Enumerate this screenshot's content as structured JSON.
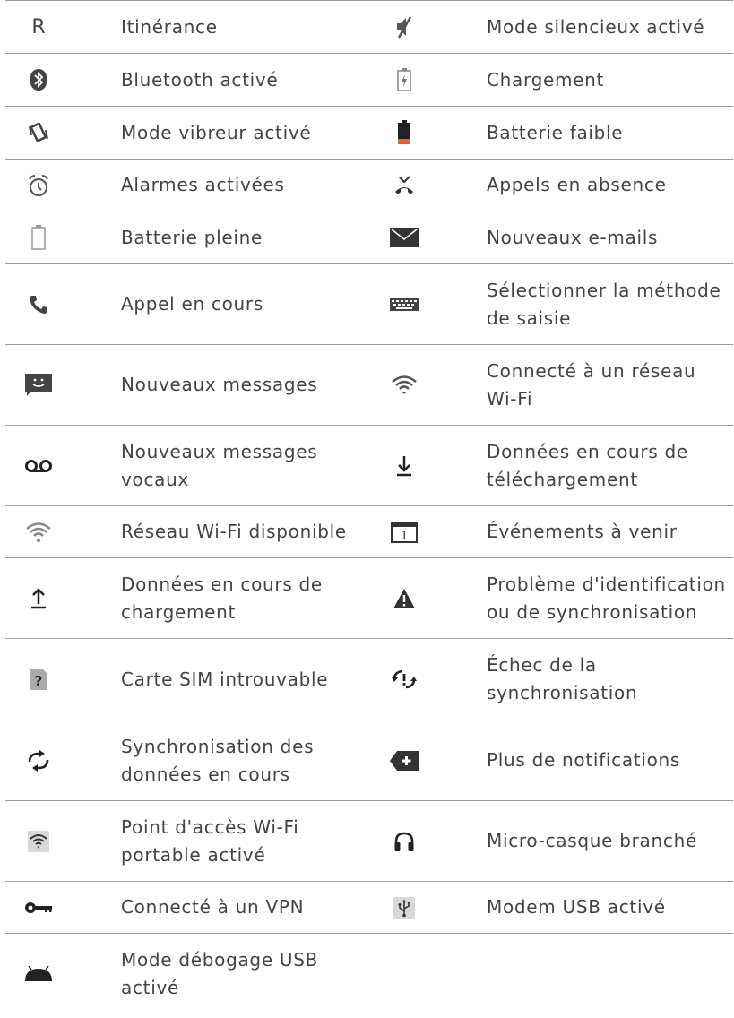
{
  "rows": [
    {
      "left_icon": "roaming-r-icon",
      "left_icon_text": "R",
      "left": "Itinérance",
      "right_icon": "silent-mode-icon",
      "right": "Mode silencieux activé"
    },
    {
      "left_icon": "bluetooth-icon",
      "left": "Bluetooth activé",
      "right_icon": "battery-charging-icon",
      "right": "Chargement"
    },
    {
      "left_icon": "vibrate-icon",
      "left": "Mode vibreur activé",
      "right_icon": "battery-low-icon",
      "right": "Batterie faible"
    },
    {
      "left_icon": "alarm-icon",
      "left": "Alarmes activées",
      "right_icon": "missed-call-icon",
      "right": "Appels en absence"
    },
    {
      "left_icon": "battery-full-icon",
      "left": "Batterie pleine",
      "right_icon": "email-icon",
      "right": "Nouveaux e-mails"
    },
    {
      "left_icon": "phone-call-icon",
      "left": "Appel en cours",
      "right_icon": "keyboard-icon",
      "right": "Sélectionner la méthode de saisie"
    },
    {
      "left_icon": "message-icon",
      "left": "Nouveaux messages",
      "right_icon": "wifi-connected-icon",
      "right": "Connecté à un réseau Wi-Fi"
    },
    {
      "left_icon": "voicemail-icon",
      "left": "Nouveaux messages vocaux",
      "right_icon": "download-icon",
      "right": "Données en cours de téléchargement"
    },
    {
      "left_icon": "wifi-available-icon",
      "left": "Réseau Wi-Fi disponible",
      "right_icon": "calendar-icon",
      "right_icon_text": "1",
      "right": "Événements à venir"
    },
    {
      "left_icon": "upload-icon",
      "left": "Données en cours de chargement",
      "right_icon": "warning-icon",
      "right": "Problème d'identification ou de synchronisation"
    },
    {
      "left_icon": "sim-missing-icon",
      "left": "Carte SIM introuvable",
      "right_icon": "sync-error-icon",
      "right": "Échec de la synchronisation"
    },
    {
      "left_icon": "sync-icon",
      "left": "Synchronisation des données en cours",
      "right_icon": "more-notifications-icon",
      "right": "Plus de notifications"
    },
    {
      "left_icon": "wifi-hotspot-icon",
      "left": "Point d'accès Wi-Fi portable activé",
      "right_icon": "headset-icon",
      "right": "Micro-casque branché"
    },
    {
      "left_icon": "vpn-key-icon",
      "left": "Connecté à un VPN",
      "right_icon": "usb-icon",
      "right": "Modem USB activé"
    },
    {
      "left_icon": "android-debug-icon",
      "left": "Mode débogage USB activé",
      "right_icon": null,
      "right": ""
    }
  ]
}
